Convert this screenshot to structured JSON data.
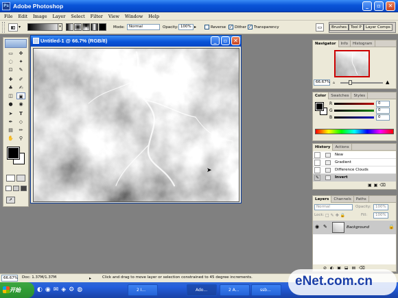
{
  "app": {
    "title": "Adobe Photoshop",
    "icon_text": "Ps"
  },
  "menu": [
    "File",
    "Edit",
    "Image",
    "Layer",
    "Select",
    "Filter",
    "View",
    "Window",
    "Help"
  ],
  "options": {
    "mode_label": "Mode:",
    "mode_value": "Normal",
    "opacity_label": "Opacity:",
    "opacity_value": "100%",
    "reverse_label": "Reverse",
    "dither_label": "Dither",
    "transparency_label": "Transparency",
    "reverse_checked": false,
    "dither_checked": true,
    "transparency_checked": true
  },
  "palette_well": [
    "Brushes",
    "Tool P",
    "Layer Comps"
  ],
  "document": {
    "title": "Untitled-1 @ 66.7% (RGB/8)"
  },
  "navigator": {
    "tabs": [
      "Navigator",
      "Info",
      "Histogram"
    ],
    "zoom": "66.67%"
  },
  "color": {
    "tabs": [
      "Color",
      "Swatches",
      "Styles"
    ],
    "channels": [
      {
        "name": "R",
        "value": "0",
        "color": "#c00000"
      },
      {
        "name": "G",
        "value": "0",
        "color": "#008000"
      },
      {
        "name": "B",
        "value": "0",
        "color": "#0000c0"
      }
    ]
  },
  "history": {
    "tabs": [
      "History",
      "Actions"
    ],
    "items": [
      "New",
      "Gradient",
      "Difference Clouds",
      "Invert"
    ],
    "selected_index": 3
  },
  "layers": {
    "tabs": [
      "Layers",
      "Channels",
      "Paths"
    ],
    "blend_mode": "Normal",
    "opacity_label": "Opacity:",
    "opacity_value": "100%",
    "lock_label": "Lock:",
    "fill_label": "Fill:",
    "fill_value": "100%",
    "layer_name": "Background"
  },
  "status": {
    "zoom": "66.67%",
    "doc": "Doc: 1.37M/1.37M",
    "hint": "Click and drag to move layer or selection constrained to 45 degree increments."
  },
  "taskbar": {
    "start": "开始",
    "buttons": [
      "2 I...",
      "Ado...",
      "2 A...",
      "ssb..."
    ],
    "clock": "10:5"
  },
  "watermark": "eNet.com.cn",
  "colors": {
    "xp_blue": "#0a54d8",
    "panel_bg": "#ece9d8",
    "workspace": "#808080",
    "selection": "#0a246a"
  }
}
